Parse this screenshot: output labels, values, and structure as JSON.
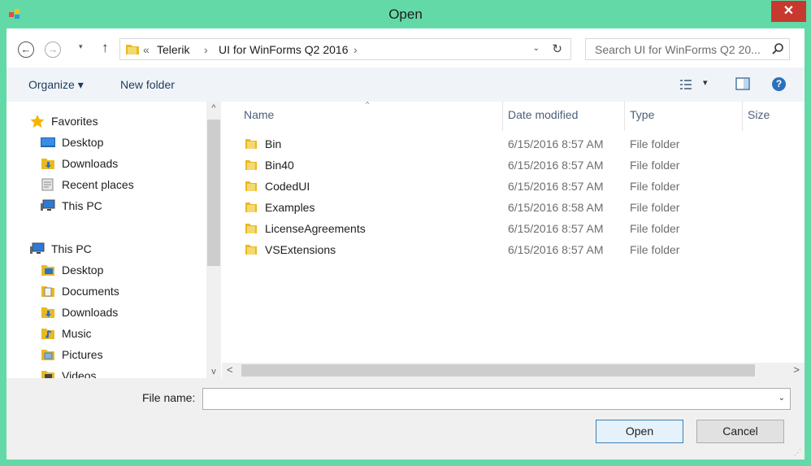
{
  "window": {
    "title": "Open",
    "close_glyph": "✕"
  },
  "nav": {
    "back_glyph": "←",
    "forward_glyph": "→",
    "up_glyph": "↑",
    "dropdown_glyph": "▾"
  },
  "address": {
    "overflow": "«",
    "crumbs": [
      "Telerik",
      "UI for WinForms Q2 2016"
    ],
    "separator": "›",
    "dropdown_glyph": "⌄",
    "refresh_glyph": "↻"
  },
  "search": {
    "placeholder": "Search UI for WinForms Q2 20..."
  },
  "toolbar": {
    "organize_label": "Organize ▾",
    "new_folder_label": "New folder",
    "view_dropdown_glyph": "▾",
    "help_glyph": "?"
  },
  "sidebar": {
    "favorites_label": "Favorites",
    "favorites": [
      {
        "label": "Desktop",
        "icon": "desktop-icon"
      },
      {
        "label": "Downloads",
        "icon": "downloads-icon"
      },
      {
        "label": "Recent places",
        "icon": "recent-places-icon"
      },
      {
        "label": "This PC",
        "icon": "computer-icon"
      }
    ],
    "thispc_label": "This PC",
    "thispc": [
      {
        "label": "Desktop",
        "icon": "desktop-folder-icon"
      },
      {
        "label": "Documents",
        "icon": "documents-icon"
      },
      {
        "label": "Downloads",
        "icon": "downloads-icon"
      },
      {
        "label": "Music",
        "icon": "music-icon"
      },
      {
        "label": "Pictures",
        "icon": "pictures-icon"
      },
      {
        "label": "Videos",
        "icon": "videos-icon"
      }
    ]
  },
  "filelist": {
    "columns": {
      "name": "Name",
      "date": "Date modified",
      "type": "Type",
      "size": "Size"
    },
    "sort_glyph": "^",
    "rows": [
      {
        "name": "Bin",
        "date": "6/15/2016 8:57 AM",
        "type": "File folder"
      },
      {
        "name": "Bin40",
        "date": "6/15/2016 8:57 AM",
        "type": "File folder"
      },
      {
        "name": "CodedUI",
        "date": "6/15/2016 8:57 AM",
        "type": "File folder"
      },
      {
        "name": "Examples",
        "date": "6/15/2016 8:58 AM",
        "type": "File folder"
      },
      {
        "name": "LicenseAgreements",
        "date": "6/15/2016 8:57 AM",
        "type": "File folder"
      },
      {
        "name": "VSExtensions",
        "date": "6/15/2016 8:57 AM",
        "type": "File folder"
      }
    ]
  },
  "scroll": {
    "up": "^",
    "down": "v",
    "left": "<",
    "right": ">"
  },
  "footer": {
    "file_name_label": "File name:",
    "file_name_value": "",
    "dropdown_glyph": "⌄",
    "open_label": "Open",
    "cancel_label": "Cancel",
    "grip_glyph": "⋰"
  },
  "colors": {
    "frame": "#63d9a8",
    "close": "#c7392f",
    "folder": "#e8b923",
    "accent_border": "#3c7fb1"
  }
}
